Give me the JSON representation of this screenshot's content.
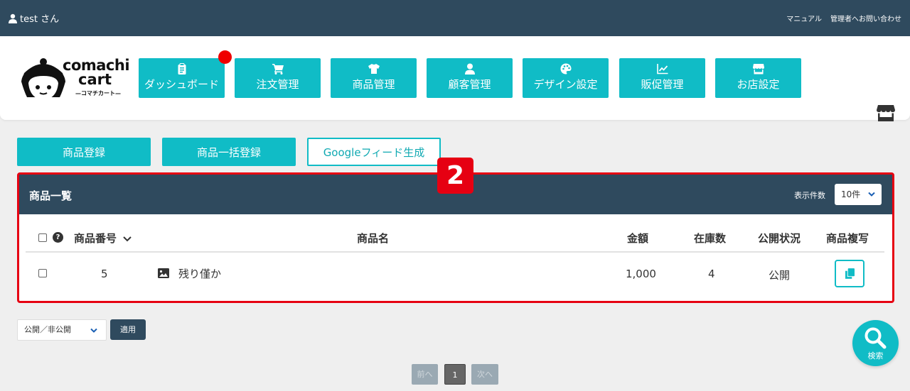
{
  "topbar": {
    "user_label": "test さん",
    "manual_link": "マニュアル",
    "contact_link": "管理者へお問い合わせ"
  },
  "logo": {
    "line1": "comachi",
    "line2": "cart",
    "line3": "—コマチカート—"
  },
  "nav": [
    {
      "label": "ダッシュボード",
      "icon": "clipboard-icon"
    },
    {
      "label": "注文管理",
      "icon": "cart-icon"
    },
    {
      "label": "商品管理",
      "icon": "tshirt-icon"
    },
    {
      "label": "顧客管理",
      "icon": "user-icon"
    },
    {
      "label": "デザイン設定",
      "icon": "palette-icon"
    },
    {
      "label": "販促管理",
      "icon": "chart-line-icon"
    },
    {
      "label": "お店設定",
      "icon": "store-icon"
    }
  ],
  "actions": {
    "register": "商品登録",
    "bulk_register": "商品一括登録",
    "google_feed": "Googleフィード生成"
  },
  "annotation_number": "2",
  "panel": {
    "title": "商品一覧",
    "count_label": "表示件数",
    "count_value": "10件"
  },
  "table": {
    "headers": {
      "help": "?",
      "number": "商品番号",
      "name": "商品名",
      "price": "金額",
      "stock": "在庫数",
      "status": "公開状況",
      "copy": "商品複写"
    },
    "rows": [
      {
        "number": "5",
        "name": "残り僅か",
        "price": "1,000",
        "stock": "4",
        "status": "公開"
      }
    ]
  },
  "bulk": {
    "select_value": "公開／非公開",
    "apply": "適用"
  },
  "pagination": {
    "prev": "前へ",
    "current": "1",
    "next": "次へ"
  },
  "search_fab": {
    "label": "検索"
  },
  "colors": {
    "accent": "#10bcc6",
    "navy": "#2f4a5e",
    "highlight": "#e60012"
  }
}
